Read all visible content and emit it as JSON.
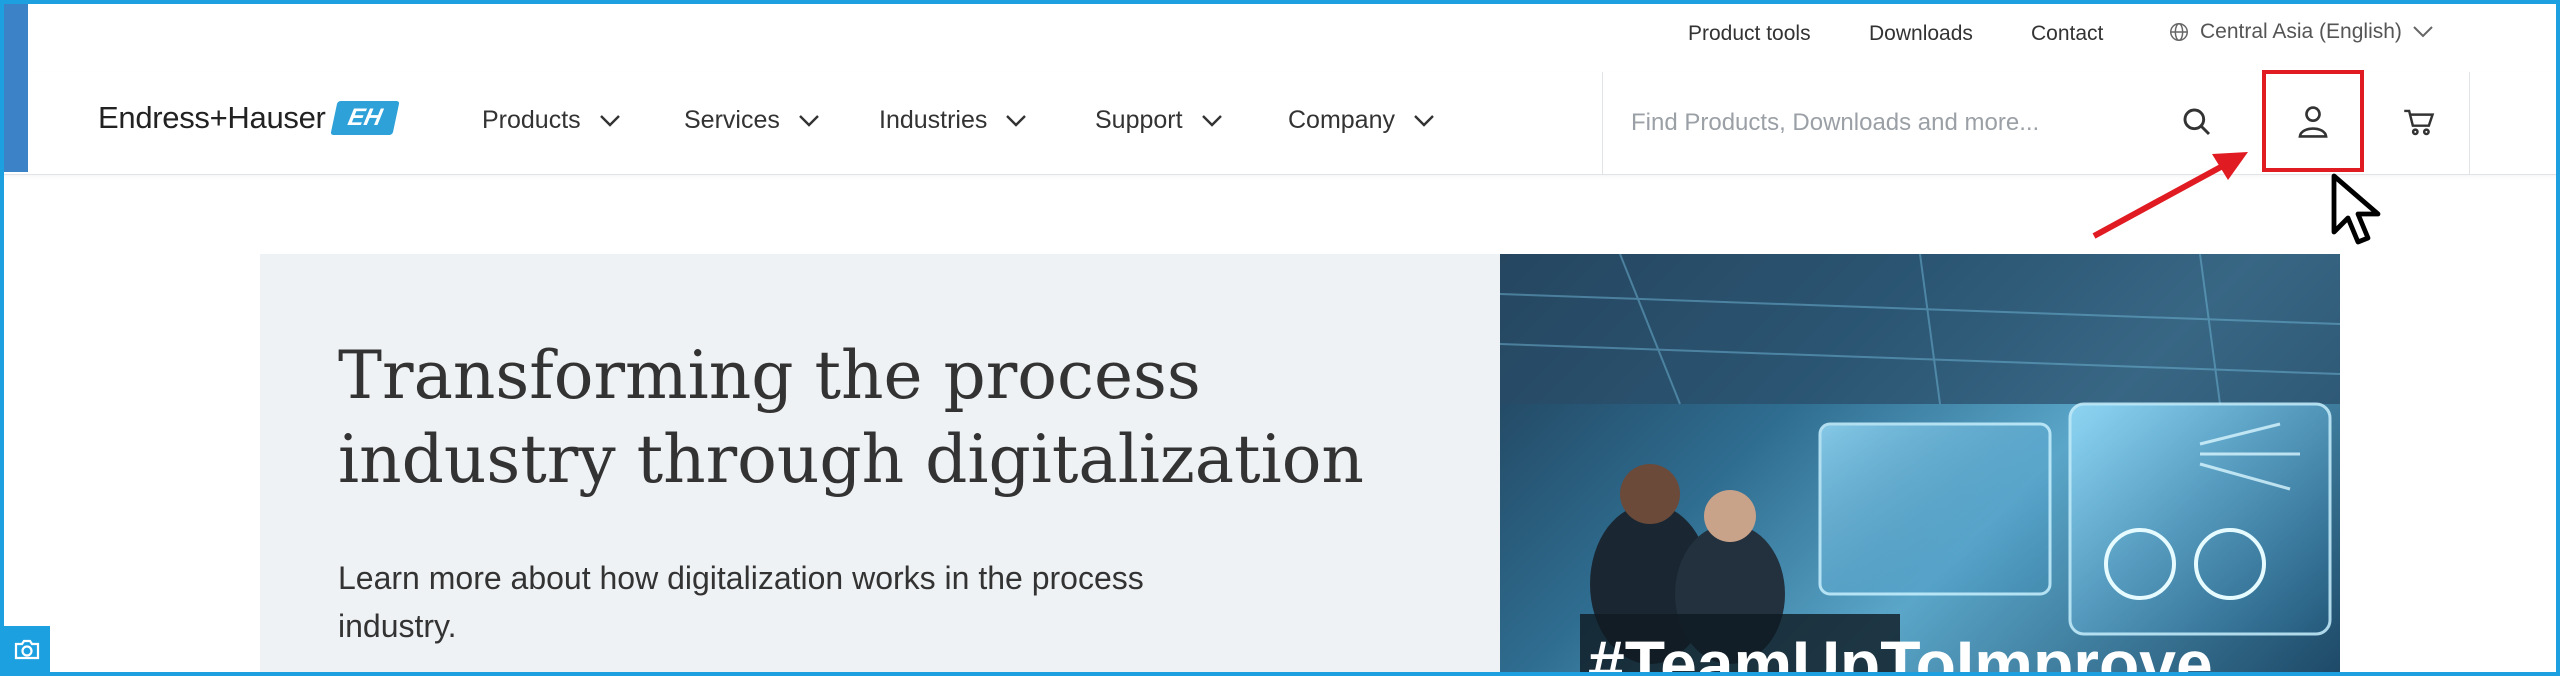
{
  "utility_bar": {
    "links": [
      "Product tools",
      "Downloads",
      "Contact"
    ],
    "region": "Central Asia (English)"
  },
  "brand": {
    "name": "Endress+Hauser",
    "mark": "EH"
  },
  "nav": {
    "items": [
      "Products",
      "Services",
      "Industries",
      "Support",
      "Company"
    ]
  },
  "search": {
    "placeholder": "Find Products, Downloads and more..."
  },
  "icons": {
    "search": "search-icon",
    "account": "user-icon",
    "cart": "cart-icon",
    "region": "globe-icon",
    "camera": "camera-icon"
  },
  "hero": {
    "title": "Transforming the process industry through digitalization",
    "subtitle": "Learn more about how digitalization works in the process industry.",
    "image_caption": "#TeamUpToImprove"
  },
  "colors": {
    "accent": "#2ea1d8",
    "frame": "#1ca0e0",
    "highlight": "#e11b22",
    "hero_bg": "#eff2f4"
  }
}
